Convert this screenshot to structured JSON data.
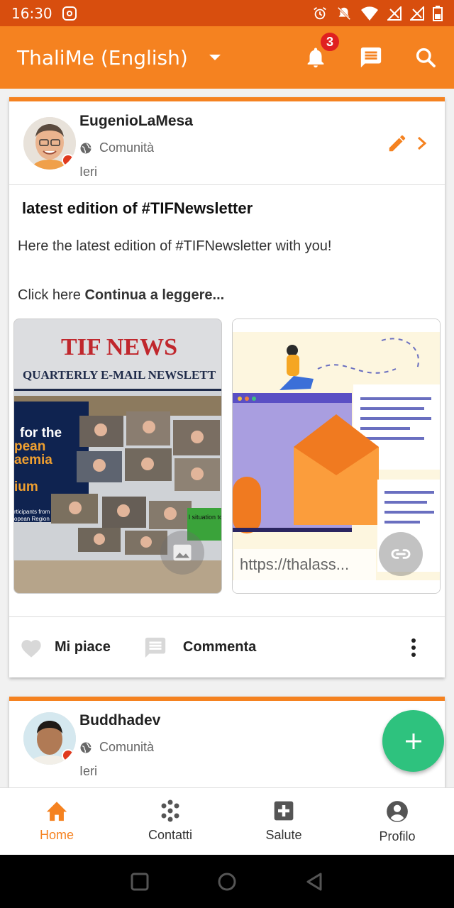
{
  "status_bar": {
    "time": "16:30"
  },
  "app_bar": {
    "title": "ThaliMe (English)",
    "notification_count": "3"
  },
  "posts": [
    {
      "author": "EugenioLaMesa",
      "audience": "Comunità",
      "date": "Ieri",
      "title": "latest edition of #TIFNewsletter",
      "body": "Here the latest edition of  #TIFNewsletter with you!",
      "read_more_prefix": "Click here ",
      "read_more_link": "Continua a leggere...",
      "media_image": {
        "heading": "TIF NEWS",
        "subheading": "QUARTERLY E-MAIL NEWSLETT",
        "panel_line1": "for the",
        "panel_line2": "pean",
        "panel_line3": "aemia",
        "panel_line4": "ium",
        "panel_small1": "rticipants from",
        "panel_small2": "opean Region",
        "side_text": "l situation to da"
      },
      "link_preview": {
        "url_text": "https://thalass..."
      },
      "like_label": "Mi piace",
      "comment_label": "Commenta"
    },
    {
      "author": "Buddhadev",
      "audience": "Comunità",
      "date": "Ieri"
    }
  ],
  "bottom_nav": [
    {
      "label": "Home",
      "icon": "home-icon",
      "active": true
    },
    {
      "label": "Contatti",
      "icon": "contacts-icon",
      "active": false
    },
    {
      "label": "Salute",
      "icon": "health-icon",
      "active": false
    },
    {
      "label": "Profilo",
      "icon": "profile-icon",
      "active": false
    }
  ],
  "colors": {
    "primary": "#f58220",
    "status_bar": "#d84e0e",
    "fab": "#2ec27e",
    "badge": "#e02020"
  }
}
